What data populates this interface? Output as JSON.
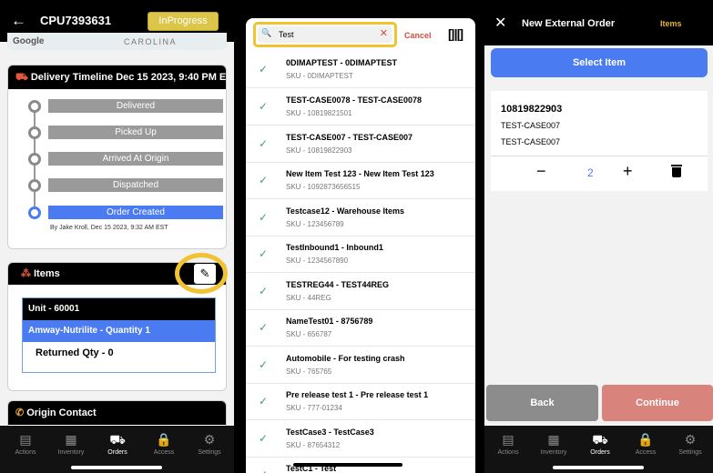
{
  "left": {
    "order_id": "CPU7393631",
    "status": "InProgress",
    "map": {
      "brand": "Google",
      "place": "CAROLINA"
    },
    "timeline": {
      "title": "Delivery Timeline Dec 15 2023, 9:40 PM EST",
      "steps": [
        "Delivered",
        "Picked Up",
        "Arrived At Origin",
        "Dispatched",
        "Order Created"
      ],
      "by": "By Jake Kroll, Dec 15 2023, 9:32 AM EST"
    },
    "items": {
      "title": "Items",
      "unit": "Unit - 60001",
      "product": "Amway-Nutrilite - Quantity 1",
      "returned": "Returned Qty - 0"
    },
    "origin_title": "Origin Contact"
  },
  "tabs": [
    {
      "label": "Actions",
      "icon": "actions-icon",
      "glyph": "▤"
    },
    {
      "label": "Inventory",
      "icon": "inventory-icon",
      "glyph": "▦"
    },
    {
      "label": "Orders",
      "icon": "truck-icon",
      "glyph": "⛟"
    },
    {
      "label": "Access",
      "icon": "lock-icon",
      "glyph": "🔒"
    },
    {
      "label": "Settings",
      "icon": "gear-icon",
      "glyph": "⚙"
    }
  ],
  "search": {
    "value": "Test",
    "cancel": "Cancel",
    "results": [
      {
        "name": "0DIMAPTEST - 0DIMAPTEST",
        "sku": "SKU - 0DIMAPTEST"
      },
      {
        "name": "TEST-CASE0078 - TEST-CASE0078",
        "sku": "SKU - 10819821501"
      },
      {
        "name": "TEST-CASE007 - TEST-CASE007",
        "sku": "SKU - 10819822903"
      },
      {
        "name": "New Item Test 123 - New Item Test 123",
        "sku": "SKU - 1092873656515"
      },
      {
        "name": "Testcase12 - Warehouse Items",
        "sku": "SKU - 123456789"
      },
      {
        "name": "TestInbound1 - Inbound1",
        "sku": "SKU - 1234567890"
      },
      {
        "name": "TESTREG44 - TEST44REG",
        "sku": "SKU - 44REG"
      },
      {
        "name": "NameTest01 - 8756789",
        "sku": "SKU - 656787"
      },
      {
        "name": "Automobile - For testing crash",
        "sku": "SKU - 765765"
      },
      {
        "name": "Pre release test 1 - Pre release test 1",
        "sku": "SKU - 777-01234"
      },
      {
        "name": "TestCase3 - TestCase3",
        "sku": "SKU - 87654312"
      },
      {
        "name": "TestC1 - Test",
        "sku": ""
      }
    ]
  },
  "right": {
    "title": "New External Order",
    "items_link": "Items",
    "select_item": "Select Item",
    "item": {
      "code": "10819822903",
      "line1": "TEST-CASE007",
      "line2": "TEST-CASE007",
      "qty": "2"
    },
    "back": "Back",
    "continue": "Continue"
  }
}
